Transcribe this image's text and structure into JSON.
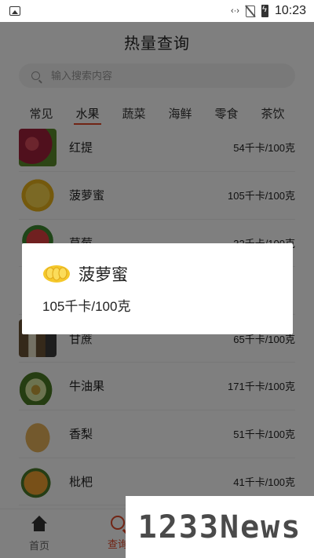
{
  "status_bar": {
    "time": "10:23",
    "icons": [
      "image-icon",
      "signal-icon",
      "no-sim-icon",
      "battery-charging-icon"
    ]
  },
  "header": {
    "title": "热量查询"
  },
  "search": {
    "placeholder": "输入搜索内容"
  },
  "tabs": [
    {
      "label": "常见",
      "active": false
    },
    {
      "label": "水果",
      "active": true
    },
    {
      "label": "蔬菜",
      "active": false
    },
    {
      "label": "海鲜",
      "active": false
    },
    {
      "label": "零食",
      "active": false
    },
    {
      "label": "茶饮",
      "active": false
    }
  ],
  "list": [
    {
      "name": "红提",
      "kcal": "54千卡/100克",
      "color": "#b0283c"
    },
    {
      "name": "菠萝蜜",
      "kcal": "105千卡/100克",
      "color": "#f1c21b"
    },
    {
      "name": "草莓",
      "kcal": "32千卡/100克",
      "color": "#d83a3a"
    },
    {
      "name": "",
      "kcal": "",
      "color": "#8a6a3a"
    },
    {
      "name": "甘蔗",
      "kcal": "65千卡/100克",
      "color": "#6e5a3a"
    },
    {
      "name": "牛油果",
      "kcal": "171千卡/100克",
      "color": "#5f8a2c"
    },
    {
      "name": "香梨",
      "kcal": "51千卡/100克",
      "color": "#d9a04a"
    },
    {
      "name": "枇杷",
      "kcal": "41千卡/100克",
      "color": "#e8902a"
    }
  ],
  "dialog": {
    "title": "菠萝蜜",
    "kcal": "105千卡/100克",
    "icon_color": "#f1c21b"
  },
  "bottom_nav": [
    {
      "label": "首页",
      "active": false
    },
    {
      "label": "查询",
      "active": true
    }
  ],
  "watermark": "1233News",
  "colors": {
    "accent": "#e34a2a",
    "overlay": "rgba(0,0,0,0.5)"
  }
}
